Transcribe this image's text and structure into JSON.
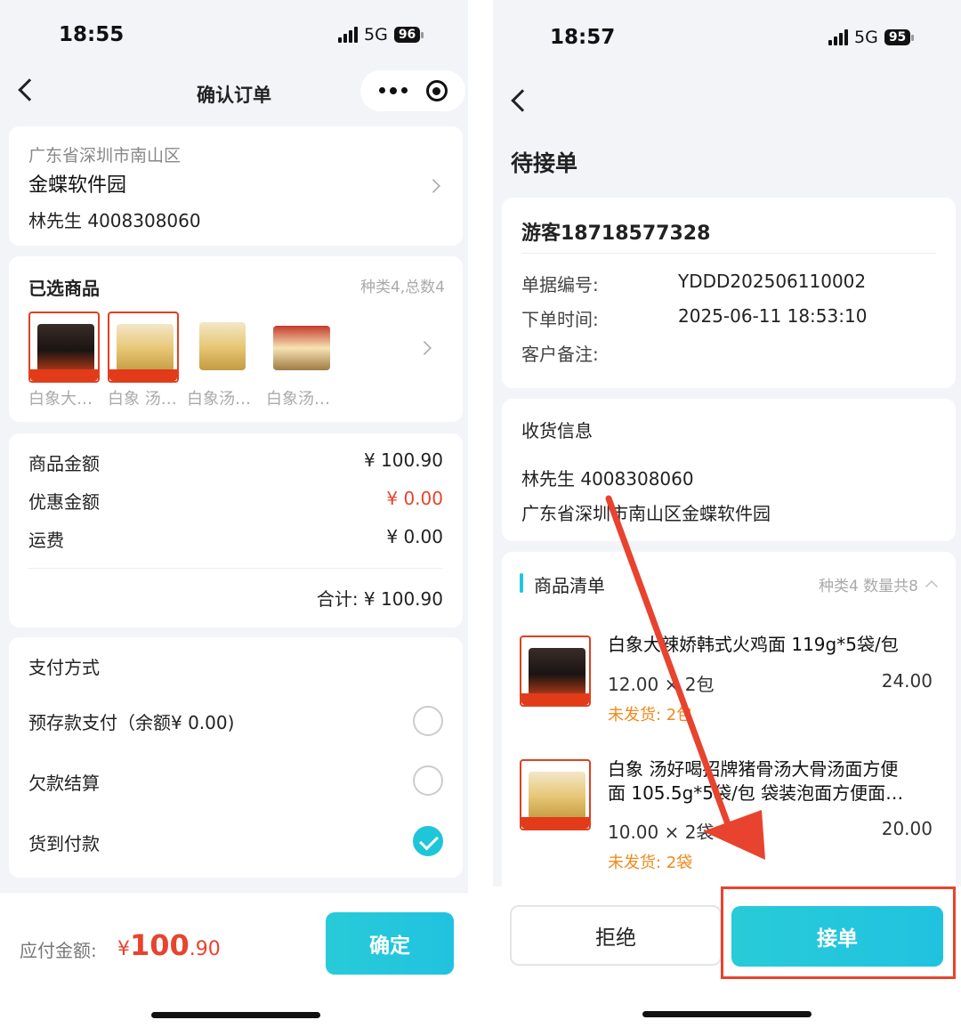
{
  "left": {
    "status": {
      "time": "18:55",
      "network": "5G",
      "battery": "96"
    },
    "nav": {
      "title": "确认订单"
    },
    "address": {
      "region": "广东省深圳市南山区",
      "detail": "金蝶软件园",
      "contact": "林先生  4008308060"
    },
    "goods": {
      "title": "已选商品",
      "summary": "种类4,总数4",
      "items": [
        {
          "name": "白象大…"
        },
        {
          "name": "白象 汤…"
        },
        {
          "name": "白象汤…"
        },
        {
          "name": "白象汤…"
        }
      ]
    },
    "amounts": {
      "goods_label": "商品金额",
      "goods_value": "¥ 100.90",
      "discount_label": "优惠金额",
      "discount_value": "¥ 0.00",
      "shipping_label": "运费",
      "shipping_value": "¥ 0.00",
      "total": "合计: ¥ 100.90"
    },
    "payment": {
      "title": "支付方式",
      "options": [
        {
          "label": "预存款支付（余额¥ 0.00)",
          "selected": false
        },
        {
          "label": "欠款结算",
          "selected": false
        },
        {
          "label": "货到付款",
          "selected": true
        }
      ]
    },
    "footer": {
      "due_label": "应付金额:",
      "currency": "¥",
      "amount_int": "100",
      "amount_dec": ".90",
      "confirm": "确定"
    }
  },
  "right": {
    "status": {
      "time": "18:57",
      "network": "5G",
      "battery": "95"
    },
    "page_title": "待接单",
    "order": {
      "customer": "游客18718577328",
      "number_label": "单据编号:",
      "number_value": "YDDD202506110002",
      "time_label": "下单时间:",
      "time_value": "2025-06-11 18:53:10",
      "remark_label": "客户备注:"
    },
    "shipping": {
      "title": "收货信息",
      "contact": "林先生 4008308060",
      "address": "广东省深圳市南山区金蝶软件园"
    },
    "list": {
      "title": "商品清单",
      "summary": "种类4 数量共8",
      "items": [
        {
          "name": "白象大辣娇韩式火鸡面 119g*5袋/包",
          "qty": "12.00 × 2包",
          "subtotal": "24.00",
          "status": "未发货: 2包"
        },
        {
          "name_line1": "白象 汤好喝招牌猪骨汤大骨汤面方便",
          "name_line2": "面 105.5g*5袋/包 袋装泡面方便面…",
          "qty": "10.00 × 2袋",
          "subtotal": "20.00",
          "status": "未发货: 2袋"
        }
      ]
    },
    "footer": {
      "reject": "拒绝",
      "accept": "接单"
    }
  },
  "colors": {
    "accent_teal": "#22c6dc",
    "price_red": "#e8432e",
    "status_orange": "#f08a1c",
    "annotation_red": "#e8432e"
  }
}
